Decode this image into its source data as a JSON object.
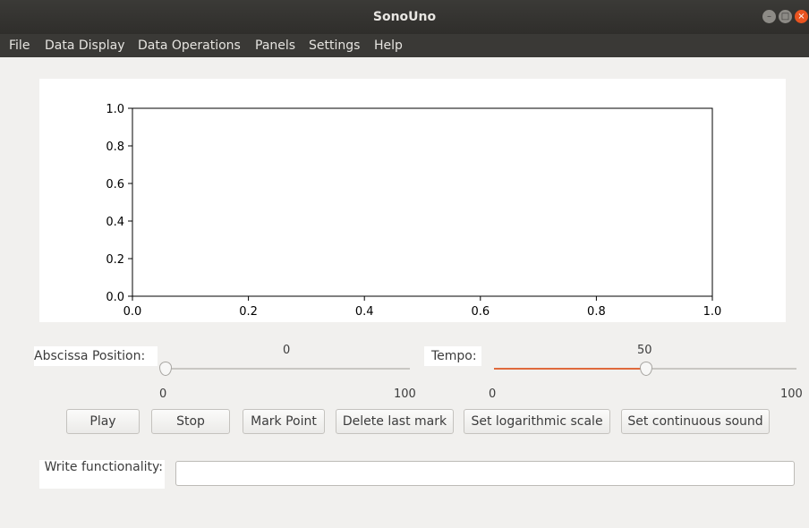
{
  "window": {
    "title": "SonoUno",
    "controls": [
      "minimize-icon",
      "maximize-icon",
      "close-icon"
    ],
    "close_color": "#e95420"
  },
  "menu": [
    "File",
    "Data Display",
    "Data Operations",
    "Panels",
    "Settings",
    "Help"
  ],
  "plot": {
    "x_ticks": [
      "0.0",
      "0.2",
      "0.4",
      "0.6",
      "0.8",
      "1.0"
    ],
    "y_ticks": [
      "0.0",
      "0.2",
      "0.4",
      "0.6",
      "0.8",
      "1.0"
    ],
    "xlim": [
      0.0,
      1.0
    ],
    "ylim": [
      0.0,
      1.0
    ]
  },
  "abscissa": {
    "label": "Abscissa Position:",
    "value": "0",
    "min_label": "0",
    "max_label": "100",
    "position": 0
  },
  "tempo": {
    "label": "Tempo:",
    "value": "50",
    "min_label": "0",
    "max_label": "100",
    "position": 0.5,
    "accent": "#e06a3c"
  },
  "buttons": {
    "play": "Play",
    "stop": "Stop",
    "mark_point": "Mark Point",
    "delete_last_mark": "Delete last mark",
    "set_log_scale": "Set logarithmic scale",
    "set_continuous_sound": "Set continuous sound"
  },
  "command": {
    "label": "Write functionality:",
    "value": ""
  }
}
